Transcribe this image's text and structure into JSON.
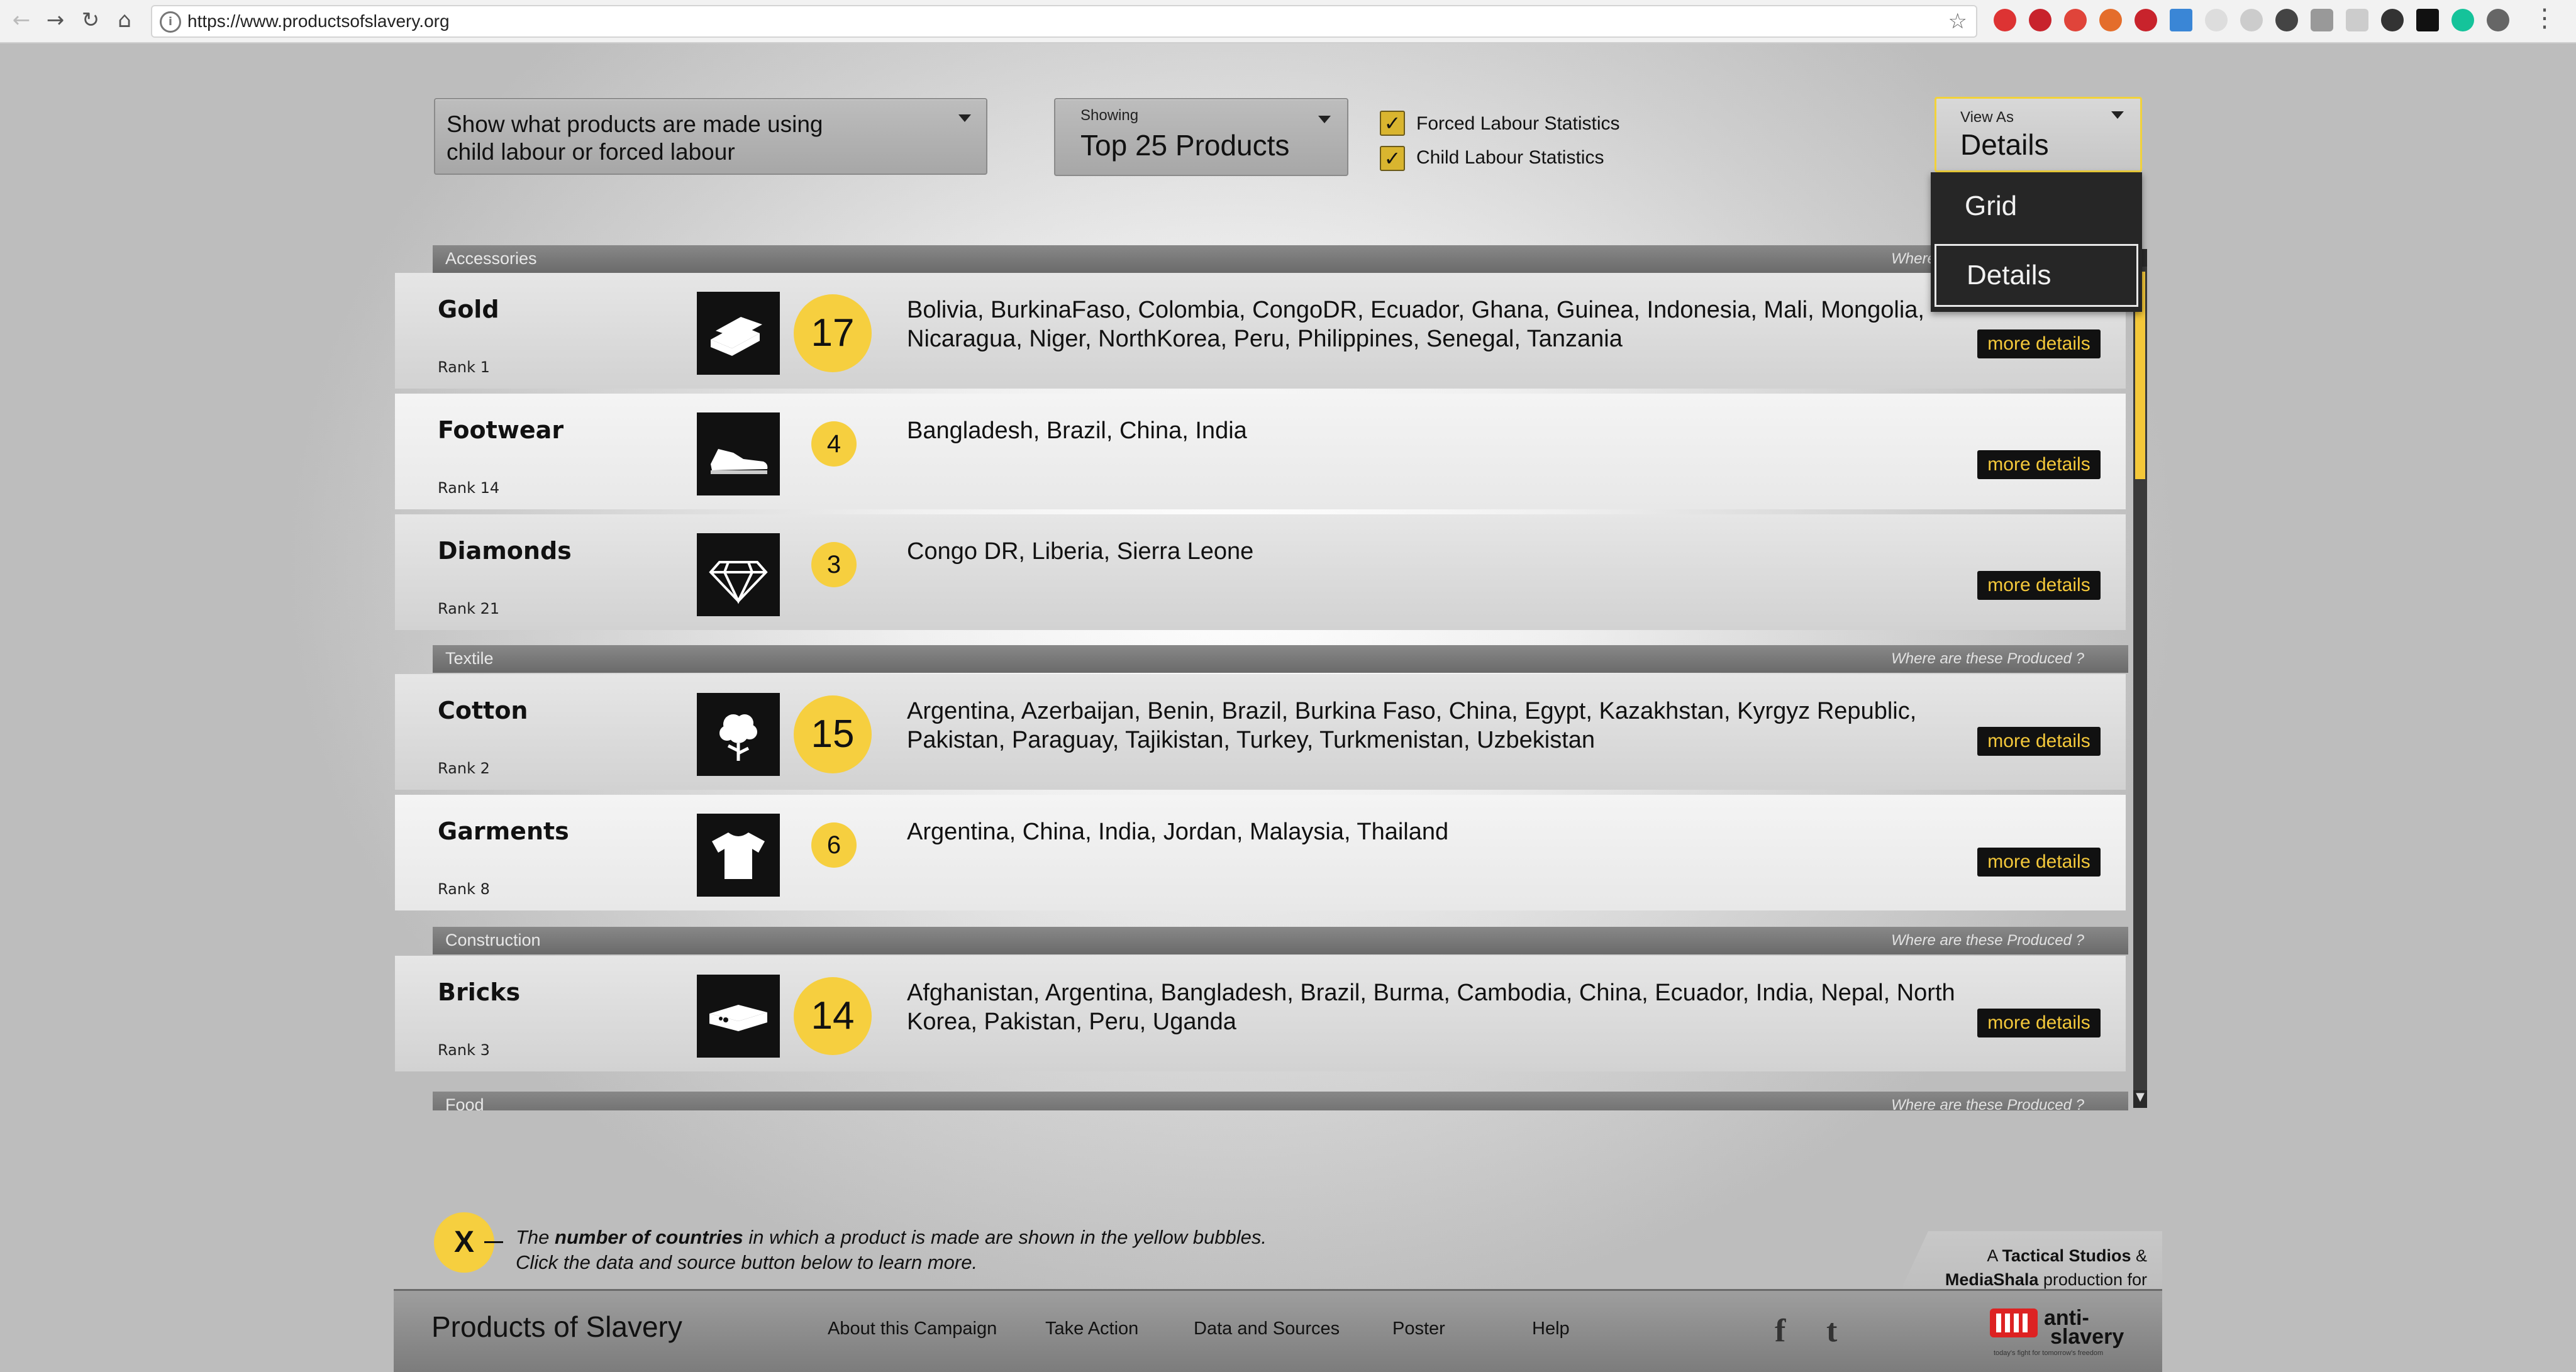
{
  "browser": {
    "url": "https://www.productsofslavery.org"
  },
  "controls": {
    "filter_line1": "Show what products are made using",
    "filter_line2": "child labour or forced labour",
    "showing_label": "Showing",
    "showing_value": "Top 25 Products",
    "forced_label": "Forced Labour Statistics",
    "forced_checked": true,
    "child_label": "Child Labour Statistics",
    "child_checked": true,
    "view_label": "View As",
    "view_value": "Details",
    "view_options": [
      "Grid",
      "Details"
    ]
  },
  "categories": [
    {
      "name": "Accessories",
      "where": "Where are these Produced ?",
      "products": [
        {
          "name": "Gold",
          "rank": "Rank 1",
          "icon": "gold-bars-icon",
          "count": "17",
          "countries": "Bolivia, BurkinaFaso, Colombia, CongoDR, Ecuador, Ghana, Guinea, Indonesia, Mali, Mongolia, Nicaragua, Niger, NorthKorea, Peru, Philippines, Senegal, Tanzania"
        },
        {
          "name": "Footwear",
          "rank": "Rank 14",
          "icon": "shoe-icon",
          "count": "4",
          "countries": "Bangladesh, Brazil, China, India"
        },
        {
          "name": "Diamonds",
          "rank": "Rank 21",
          "icon": "diamond-icon",
          "count": "3",
          "countries": "Congo DR, Liberia, Sierra Leone"
        }
      ]
    },
    {
      "name": "Textile",
      "where": "Where are these Produced ?",
      "products": [
        {
          "name": "Cotton",
          "rank": "Rank 2",
          "icon": "cotton-plant-icon",
          "count": "15",
          "countries": "Argentina, Azerbaijan, Benin, Brazil, Burkina Faso, China, Egypt, Kazakhstan, Kyrgyz Republic, Pakistan, Paraguay, Tajikistan, Turkey, Turkmenistan, Uzbekistan"
        },
        {
          "name": "Garments",
          "rank": "Rank 8",
          "icon": "tshirt-icon",
          "count": "6",
          "countries": "Argentina, China, India, Jordan, Malaysia, Thailand"
        }
      ]
    },
    {
      "name": "Construction",
      "where": "Where are these Produced ?",
      "products": [
        {
          "name": "Bricks",
          "rank": "Rank 3",
          "icon": "bricks-icon",
          "count": "14",
          "countries": "Afghanistan, Argentina, Bangladesh, Brazil, Burma, Cambodia, China, Ecuador, India, Nepal, North Korea, Pakistan, Peru, Uganda"
        }
      ]
    },
    {
      "name": "Food",
      "where": "Where are these Produced ?",
      "products": []
    }
  ],
  "more_label": "more details",
  "legend": {
    "symbol": "X",
    "part1": "The ",
    "bold": "number of countries",
    "part2": " in which a product is made are shown in the yellow bubbles.",
    "line2": "Click the data and source button below to learn more."
  },
  "footer": {
    "brand": "Products of Slavery",
    "nav": [
      "About this Campaign",
      "Take Action",
      "Data and Sources",
      "Poster",
      "Help"
    ],
    "social": [
      "facebook-icon",
      "twitter-icon"
    ],
    "credit_a": "A ",
    "credit_tactical": "Tactical Studios",
    "credit_amp": " &",
    "credit_mediashala": "MediaShala",
    "credit_tail": " production for",
    "logo_text1": "anti-",
    "logo_text2": "slavery",
    "logo_tagline": "today's fight for tomorrow's freedom"
  },
  "colors": {
    "accent_yellow": "#f6cf3f",
    "more_text": "#f4c83a",
    "dark": "#111111"
  }
}
